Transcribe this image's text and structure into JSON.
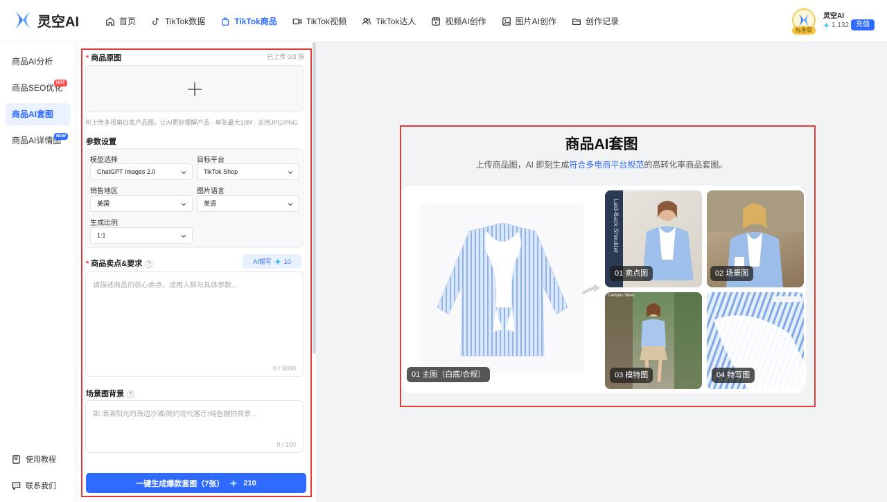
{
  "brand": {
    "name": "灵空AI"
  },
  "nav": [
    {
      "label": "首页",
      "icon": "home-icon"
    },
    {
      "label": "TikTok数据",
      "icon": "tiktok-icon"
    },
    {
      "label": "TikTok商品",
      "icon": "bag-icon"
    },
    {
      "label": "TikTok视频",
      "icon": "video-icon"
    },
    {
      "label": "TikTok达人",
      "icon": "users-icon"
    },
    {
      "label": "视频AI创作",
      "icon": "film-icon"
    },
    {
      "label": "图片AI创作",
      "icon": "image-icon"
    },
    {
      "label": "创作记录",
      "icon": "folder-icon"
    }
  ],
  "nav_active": "TikTok商品",
  "user": {
    "plan": "标准版",
    "name": "灵空AI",
    "credits": "1,132",
    "recharge": "充值"
  },
  "sidebar": {
    "items": [
      {
        "label": "商品AI分析"
      },
      {
        "label": "商品SEO优化",
        "tag": "HOT"
      },
      {
        "label": "商品AI套图"
      },
      {
        "label": "商品AI详情图",
        "tag": "NEW"
      }
    ],
    "active": "商品AI套图",
    "bottom": [
      {
        "label": "使用教程",
        "icon": "book-icon"
      },
      {
        "label": "联系我们",
        "icon": "chat-icon"
      }
    ]
  },
  "form": {
    "upload": {
      "title": "商品原图",
      "status": "已上传 0/3 张",
      "hint": "可上传多视角白底产品图，让AI更好理解产品 · 单张最大10M · 支持JPG/PNG"
    },
    "params": {
      "title": "参数设置",
      "model_label": "模型选择",
      "model_value": "ChatGPT Images 2.0",
      "platform_label": "目标平台",
      "platform_value": "TikTok Shop",
      "region_label": "销售地区",
      "region_value": "美国",
      "language_label": "图片语言",
      "language_value": "英语",
      "ratio_label": "生成比例",
      "ratio_value": "1:1"
    },
    "selling": {
      "title": "商品卖点&要求",
      "ai_write": "AI帮写",
      "ai_cost": "10",
      "placeholder": "请描述商品的核心卖点、适用人群与具体参数...",
      "counter": "0 / 5000"
    },
    "scene": {
      "title": "场景图背景",
      "placeholder": "如:洒满阳光的海边沙滩/简约现代客厅/纯色棚拍背景...",
      "counter": "0 / 100"
    },
    "generate": {
      "label": "一键生成爆款套图（7张）",
      "cost": "210"
    }
  },
  "hero": {
    "title": "商品AI套图",
    "subtitle_pre": "上传商品图，AI 即刻生成",
    "subtitle_link": "符合多电商平台规范",
    "subtitle_post": "的高转化率商品套图。",
    "images": [
      {
        "label": "01 主图（白底/合规）"
      },
      {
        "label": "01 卖点图",
        "overlay": "Laid-Back Shoulder"
      },
      {
        "label": "02 场景图"
      },
      {
        "label": "03 模特图",
        "overlay": "Campus Vibes"
      },
      {
        "label": "04 特写图"
      }
    ]
  },
  "colors": {
    "accent": "#2f6bff",
    "highlight_box": "#e53935",
    "bg": "#f2f3f5"
  }
}
